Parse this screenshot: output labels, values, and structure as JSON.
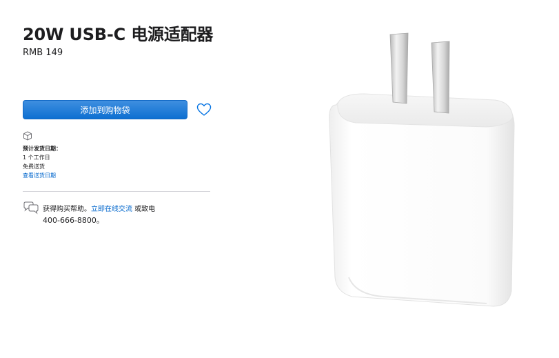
{
  "product": {
    "title": "20W USB-C 电源适配器",
    "price": "RMB 149"
  },
  "actions": {
    "add_to_bag_label": "添加到购物袋"
  },
  "delivery": {
    "label": "预计发货日期：",
    "days": "1 个工作日",
    "shipping": "免费送货",
    "link": "查看送货日期"
  },
  "help": {
    "prefix": "获得购买帮助。",
    "chat_link": "立即在线交流",
    "suffix": " 或致电",
    "phone": "400-666-8800。"
  },
  "colors": {
    "accent": "#0071e3",
    "link": "#0066cc"
  },
  "icons": [
    "box-icon",
    "heart-icon",
    "chat-icon"
  ]
}
